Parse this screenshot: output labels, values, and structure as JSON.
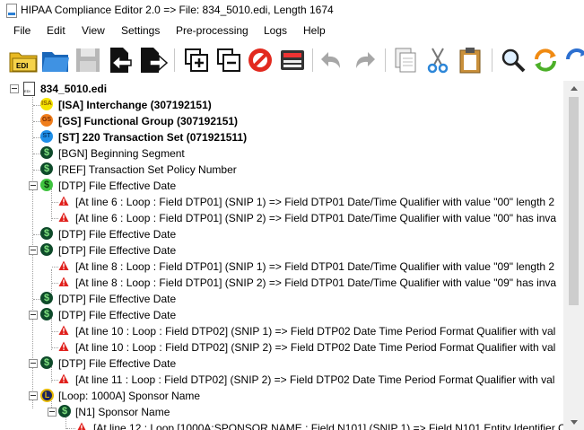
{
  "window": {
    "title": "HIPAA Compliance Editor 2.0 => File: 834_5010.edi, Length 1674"
  },
  "menu": [
    "File",
    "Edit",
    "View",
    "Settings",
    "Pre-processing",
    "Logs",
    "Help"
  ],
  "toolbar": {
    "buttons": [
      "open-edi-icon",
      "open-folder-icon",
      "save-icon",
      "import-icon",
      "export-icon",
      "add-segment-icon",
      "remove-segment-icon",
      "stop-icon",
      "edit-record-icon",
      "undo-icon",
      "redo-icon",
      "copy-icon",
      "cut-icon",
      "paste-icon",
      "search-icon",
      "refresh-icon",
      "sync-icon"
    ],
    "edi_badge": "EDI"
  },
  "tree": {
    "rows": [
      {
        "label": "834_5010.edi",
        "bold": true,
        "icon": "file"
      },
      {
        "label": "[ISA] Interchange (307192151)",
        "bold": true,
        "icon": "isa",
        "badge": "ISA"
      },
      {
        "label": "[GS] Functional Group (307192151)",
        "bold": true,
        "icon": "gs",
        "badge": "GS"
      },
      {
        "label": "[ST] 220 Transaction Set (071921511)",
        "bold": true,
        "icon": "st",
        "badge": "ST"
      },
      {
        "label": "[BGN] Beginning Segment",
        "icon": "segment"
      },
      {
        "label": "[REF] Transaction Set Policy Number",
        "icon": "segment"
      },
      {
        "label": "[DTP] File Effective Date",
        "icon": "segment-green"
      },
      {
        "label": "[At line 6 : Loop  : Field DTP01] (SNIP 1) => Field DTP01 Date/Time Qualifier with value \"00\" length 2",
        "icon": "warn"
      },
      {
        "label": "[At line 6 : Loop  : Field DTP01] (SNIP 2) => Field DTP01 Date/Time Qualifier with value \"00\" has inva",
        "icon": "warn"
      },
      {
        "label": "[DTP] File Effective Date",
        "icon": "segment"
      },
      {
        "label": "[DTP] File Effective Date",
        "icon": "segment"
      },
      {
        "label": "[At line 8 : Loop  : Field DTP01] (SNIP 1) => Field DTP01 Date/Time Qualifier with value \"09\" length 2",
        "icon": "warn"
      },
      {
        "label": "[At line 8 : Loop  : Field DTP01] (SNIP 2) => Field DTP01 Date/Time Qualifier with value \"09\" has inva",
        "icon": "warn"
      },
      {
        "label": "[DTP] File Effective Date",
        "icon": "segment"
      },
      {
        "label": "[DTP] File Effective Date",
        "icon": "segment"
      },
      {
        "label": "[At line 10 : Loop  : Field DTP02] (SNIP 1) => Field DTP02 Date Time Period Format Qualifier with val",
        "icon": "warn"
      },
      {
        "label": "[At line 10 : Loop  : Field DTP02] (SNIP 2) => Field DTP02 Date Time Period Format Qualifier with val",
        "icon": "warn"
      },
      {
        "label": "[DTP] File Effective Date",
        "icon": "segment"
      },
      {
        "label": "[At line 11 : Loop  : Field DTP02] (SNIP 2) => Field DTP02 Date Time Period Format Qualifier with val",
        "icon": "warn"
      },
      {
        "label": "[Loop: 1000A] Sponsor Name",
        "icon": "loop",
        "badge": "L"
      },
      {
        "label": "[N1] Sponsor Name",
        "icon": "segment"
      },
      {
        "label": "[At line 12 : Loop [1000A:SPONSOR NAME : Field N101] (SNIP 1) => Field N101 Entity Identifier C",
        "icon": "warn"
      }
    ]
  },
  "colors": {
    "warning": "#e0201c",
    "segment_dark": "#0e4a2a",
    "segment_green": "#3fc33f",
    "isa": "#f4e400",
    "gs": "#f07e1c",
    "st": "#1f8fe8",
    "loop": "#1c2360",
    "loop_ring": "#e6b800"
  }
}
